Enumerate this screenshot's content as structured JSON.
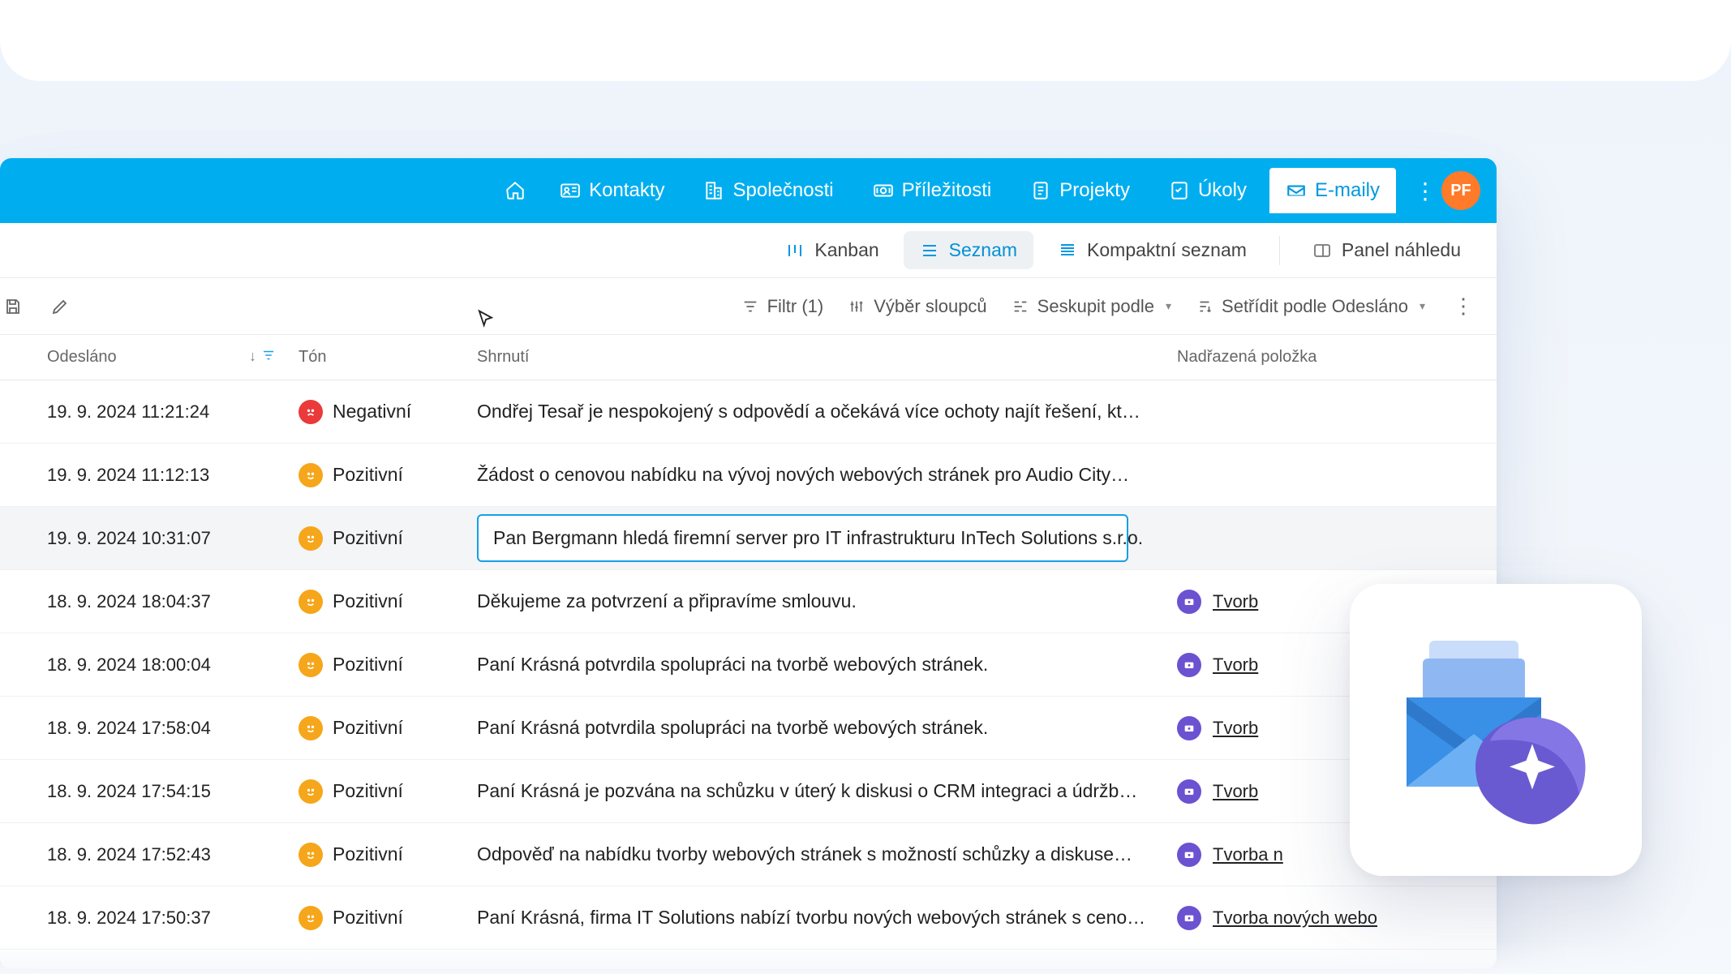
{
  "nav": {
    "items": [
      {
        "label": "Kontakty"
      },
      {
        "label": "Společnosti"
      },
      {
        "label": "Příležitosti"
      },
      {
        "label": "Projekty"
      },
      {
        "label": "Úkoly"
      },
      {
        "label": "E-maily"
      }
    ],
    "avatar": "PF"
  },
  "viewbar": {
    "kanban": "Kanban",
    "seznam": "Seznam",
    "kompakt": "Kompaktní seznam",
    "panel": "Panel náhledu"
  },
  "toolbar": {
    "filter": "Filtr (1)",
    "columns": "Výběr sloupců",
    "group": "Seskupit podle",
    "sort": "Setřídit podle Odesláno"
  },
  "columns": {
    "sent": "Odesláno",
    "tone": "Tón",
    "summary": "Shrnutí",
    "parent": "Nadřazená položka"
  },
  "tone_labels": {
    "pos": "Pozitivní",
    "neg": "Negativní"
  },
  "rows": [
    {
      "sent": "19. 9. 2024 11:21:24",
      "tone": "neg",
      "summary": "Ondřej Tesař je nespokojený s odpovědí a očekává více ochoty najít řešení, kt…",
      "parent": ""
    },
    {
      "sent": "19. 9. 2024 11:12:13",
      "tone": "pos",
      "summary": "Žádost o cenovou nabídku na vývoj nových webových stránek pro Audio City…",
      "parent": ""
    },
    {
      "sent": "19. 9. 2024 10:31:07",
      "tone": "pos",
      "summary": "Pan Bergmann hledá firemní server pro IT infrastrukturu InTech Solutions s.r.o.",
      "parent": "",
      "selected": true
    },
    {
      "sent": "18. 9. 2024 18:04:37",
      "tone": "pos",
      "summary": "Děkujeme za potvrzení a připravíme smlouvu.",
      "parent": "Tvorb"
    },
    {
      "sent": "18. 9. 2024 18:00:04",
      "tone": "pos",
      "summary": "Paní Krásná potvrdila spolupráci na tvorbě webových stránek.",
      "parent": "Tvorb"
    },
    {
      "sent": "18. 9. 2024 17:58:04",
      "tone": "pos",
      "summary": "Paní Krásná potvrdila spolupráci na tvorbě webových stránek.",
      "parent": "Tvorb"
    },
    {
      "sent": "18. 9. 2024 17:54:15",
      "tone": "pos",
      "summary": "Paní Krásná je pozvána na schůzku v úterý k diskusi o CRM integraci a údržb…",
      "parent": "Tvorb"
    },
    {
      "sent": "18. 9. 2024 17:52:43",
      "tone": "pos",
      "summary": "Odpověď na nabídku tvorby webových stránek s možností schůzky a diskuse…",
      "parent": "Tvorba n"
    },
    {
      "sent": "18. 9. 2024 17:50:37",
      "tone": "pos",
      "summary": "Paní Krásná, firma IT Solutions nabízí tvorbu nových webových stránek s ceno…",
      "parent": "Tvorba nových webo"
    }
  ]
}
